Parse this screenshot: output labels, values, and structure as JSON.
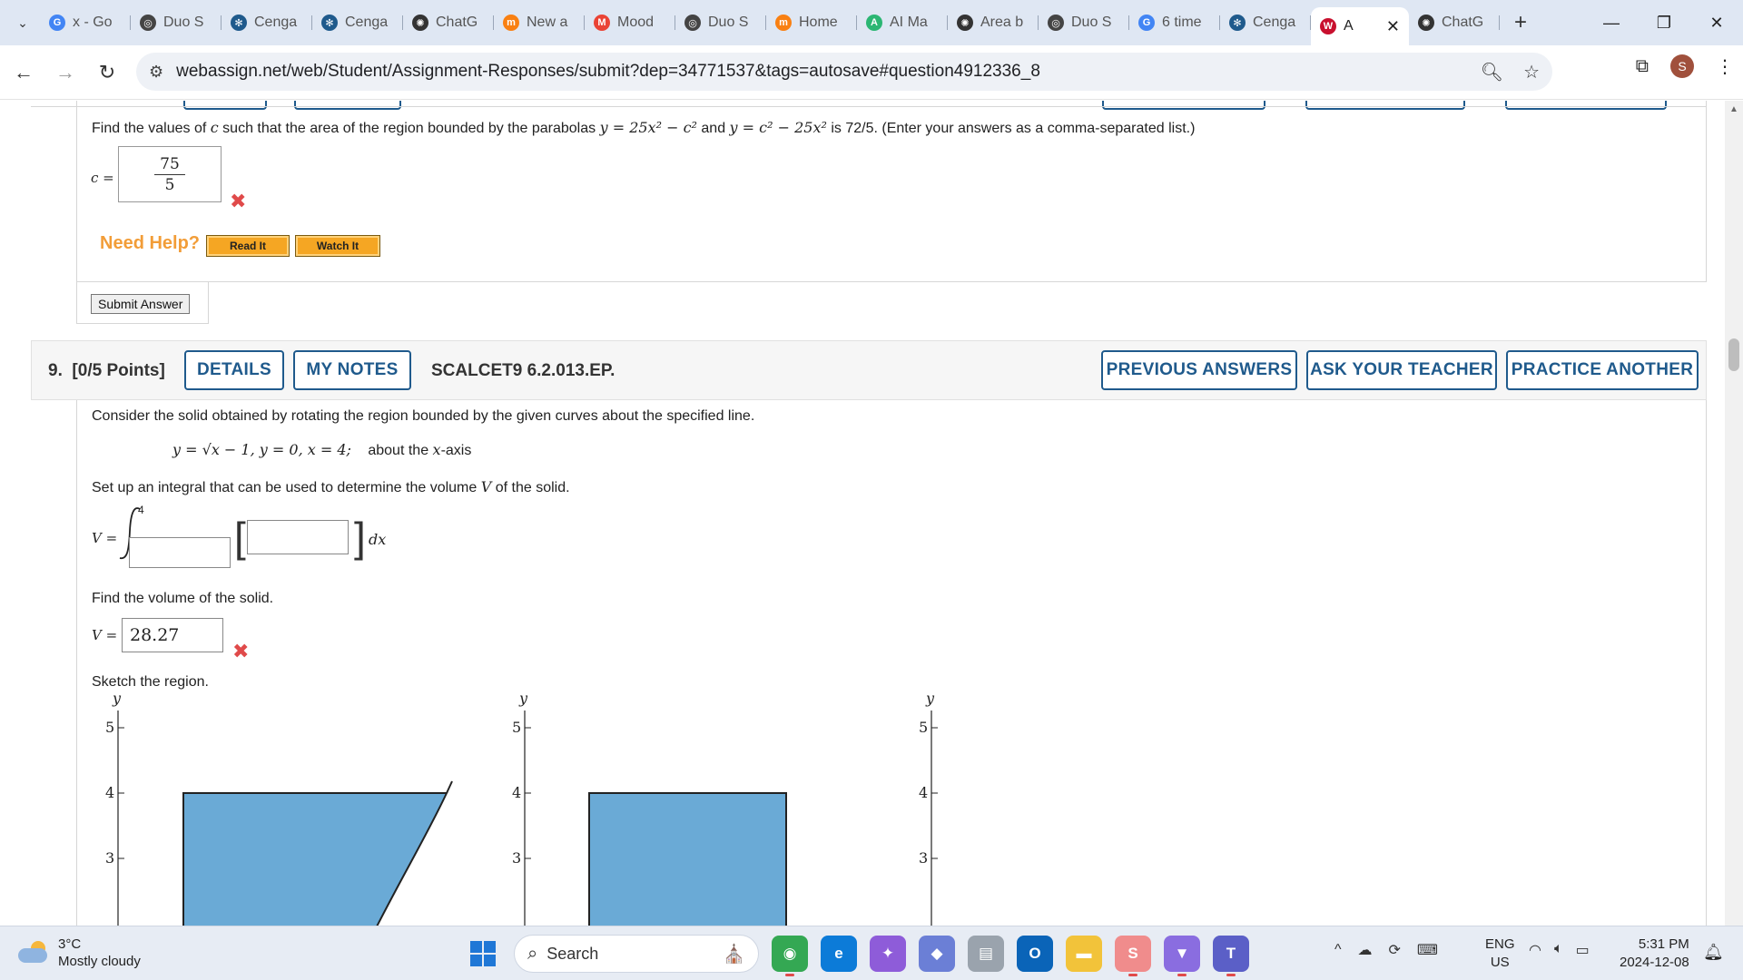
{
  "browser": {
    "tabs": [
      {
        "label": "x - Go",
        "icon": "google-icon",
        "color": "#4285f4",
        "glyph": "G"
      },
      {
        "label": "Duo S",
        "icon": "duo-icon",
        "color": "#444444",
        "glyph": "◎"
      },
      {
        "label": "Cenga",
        "icon": "cengage-icon",
        "color": "#1f5a8c",
        "glyph": "✻"
      },
      {
        "label": "Cenga",
        "icon": "cengage-icon",
        "color": "#1f5a8c",
        "glyph": "✻"
      },
      {
        "label": "ChatG",
        "icon": "chatgpt-icon",
        "color": "#333333",
        "glyph": "✺"
      },
      {
        "label": "New a",
        "icon": "moodle-icon",
        "color": "#f98012",
        "glyph": "m"
      },
      {
        "label": "Mood",
        "icon": "gmail-icon",
        "color": "#ea4335",
        "glyph": "M"
      },
      {
        "label": "Duo S",
        "icon": "duo-icon",
        "color": "#444444",
        "glyph": "◎"
      },
      {
        "label": "Home",
        "icon": "moodle-icon",
        "color": "#f98012",
        "glyph": "m"
      },
      {
        "label": "AI Ma",
        "icon": "ai-math-icon",
        "color": "#2bb673",
        "glyph": "A"
      },
      {
        "label": "Area b",
        "icon": "chatgpt-icon",
        "color": "#333333",
        "glyph": "✺"
      },
      {
        "label": "Duo S",
        "icon": "duo-icon",
        "color": "#444444",
        "glyph": "◎"
      },
      {
        "label": "6 time",
        "icon": "google-icon",
        "color": "#4285f4",
        "glyph": "G"
      },
      {
        "label": "Cenga",
        "icon": "cengage-icon",
        "color": "#1f5a8c",
        "glyph": "✻"
      },
      {
        "label": "A",
        "icon": "webassign-icon",
        "color": "#c8102e",
        "glyph": "W",
        "active": true
      },
      {
        "label": "ChatG",
        "icon": "chatgpt-icon",
        "color": "#333333",
        "glyph": "✺"
      }
    ],
    "url": "webassign.net/web/Student/Assignment-Responses/submit?dep=34771537&tags=autosave#question4912336_8",
    "profile_initial": "S"
  },
  "prev_question": {
    "prompt_pre": "Find the values of ",
    "prompt_var": "c",
    "prompt_mid": " such that the area of the region bounded by the parabolas ",
    "eq1": "y = 25x² − c²",
    "and": " and ",
    "eq2": "y = c² − 25x²",
    "prompt_post": " is 72/5. (Enter your answers as a comma-separated list.)",
    "answer_label": "c =",
    "answer_num": "75",
    "answer_den": "5",
    "need_help": "Need Help?",
    "read_it": "Read It",
    "watch_it": "Watch It",
    "submit": "Submit Answer"
  },
  "question": {
    "number": "9.",
    "points": "[0/5 Points]",
    "details": "DETAILS",
    "my_notes": "MY NOTES",
    "code": "SCALCET9 6.2.013.EP.",
    "previous_answers": "PREVIOUS ANSWERS",
    "ask_teacher": "ASK YOUR TEACHER",
    "practice_another": "PRACTICE ANOTHER",
    "intro": "Consider the solid obtained by rotating the region bounded by the given curves about the specified line.",
    "curves": "y = √x − 1,  y = 0,  x = 4;",
    "axis_pre": "about the ",
    "axis_var": "x",
    "axis_post": "-axis",
    "setup_pre": "Set up an integral that can be used to determine the volume ",
    "setup_var": "V",
    "setup_post": " of the solid.",
    "v_label": "V =",
    "upper_limit": "4",
    "dx": "dx",
    "find_volume": "Find the volume of the solid.",
    "volume_value": "28.27",
    "sketch": "Sketch the region."
  },
  "graphs": [
    {
      "ylabel": "y",
      "ticks": [
        "5",
        "4",
        "3"
      ],
      "shape": "curved"
    },
    {
      "ylabel": "y",
      "ticks": [
        "5",
        "4",
        "3"
      ],
      "shape": "rect"
    },
    {
      "ylabel": "y",
      "ticks": [
        "5",
        "4",
        "3"
      ],
      "shape": "none"
    }
  ],
  "taskbar": {
    "temp": "3°C",
    "condition": "Mostly cloudy",
    "search": "Search",
    "lang1": "ENG",
    "lang2": "US",
    "time": "5:31 PM",
    "date": "2024-12-08"
  },
  "colors": {
    "accent": "#1f5a8c",
    "region_fill": "#6aaad6",
    "error": "#e04a4a",
    "help_orange": "#f29d38"
  }
}
